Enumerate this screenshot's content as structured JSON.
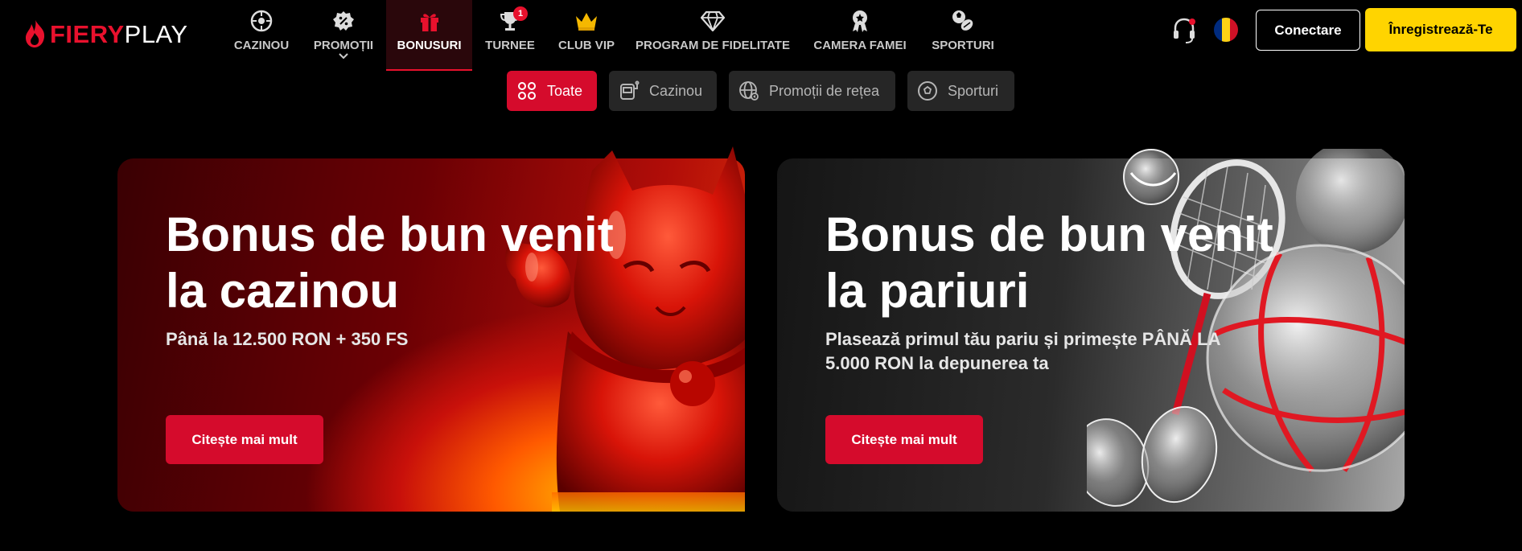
{
  "brand": {
    "logo_part1": "FIERY",
    "logo_part2": "PLAY",
    "accent": "#e8112d",
    "cta_yellow": "#ffd400"
  },
  "nav": {
    "items": [
      {
        "label": "CAZINOU",
        "icon": "roulette-icon"
      },
      {
        "label": "PROMOȚII",
        "icon": "percent-badge-icon"
      },
      {
        "label": "BONUSURI",
        "icon": "gift-icon",
        "active": true
      },
      {
        "label": "TURNEE",
        "icon": "trophy-icon",
        "badge": "1"
      },
      {
        "label": "CLUB VIP",
        "icon": "crown-icon"
      },
      {
        "label": "PROGRAM DE FIDELITATE",
        "icon": "diamond-icon"
      },
      {
        "label": "CAMERA FAMEI",
        "icon": "award-ribbon-icon"
      },
      {
        "label": "SPORTURI",
        "icon": "sports-balls-icon"
      }
    ]
  },
  "header_actions": {
    "support_icon": "headset-icon",
    "language_flag": "romania-flag",
    "login_label": "Conectare",
    "register_label": "Înregistrează-Te"
  },
  "filters": [
    {
      "label": "Toate",
      "icon": "grid-icon",
      "active": true
    },
    {
      "label": "Cazinou",
      "icon": "slot-machine-icon"
    },
    {
      "label": "Promoții de rețea",
      "icon": "globe-network-icon"
    },
    {
      "label": "Sporturi",
      "icon": "soccer-ball-icon"
    }
  ],
  "cards": [
    {
      "title": "Bonus de bun venit la cazinou",
      "subtitle": "Până la 12.500 RON + 350 FS",
      "cta": "Citește mai mult",
      "art": "lucky-cat-figure"
    },
    {
      "title": "Bonus de bun venit la pariuri",
      "subtitle": "Plasează primul tău pariu și primește PÂNĂ LA 5.000 RON la depunerea ta",
      "cta": "Citește mai mult",
      "art": "sports-balls-racket"
    }
  ]
}
